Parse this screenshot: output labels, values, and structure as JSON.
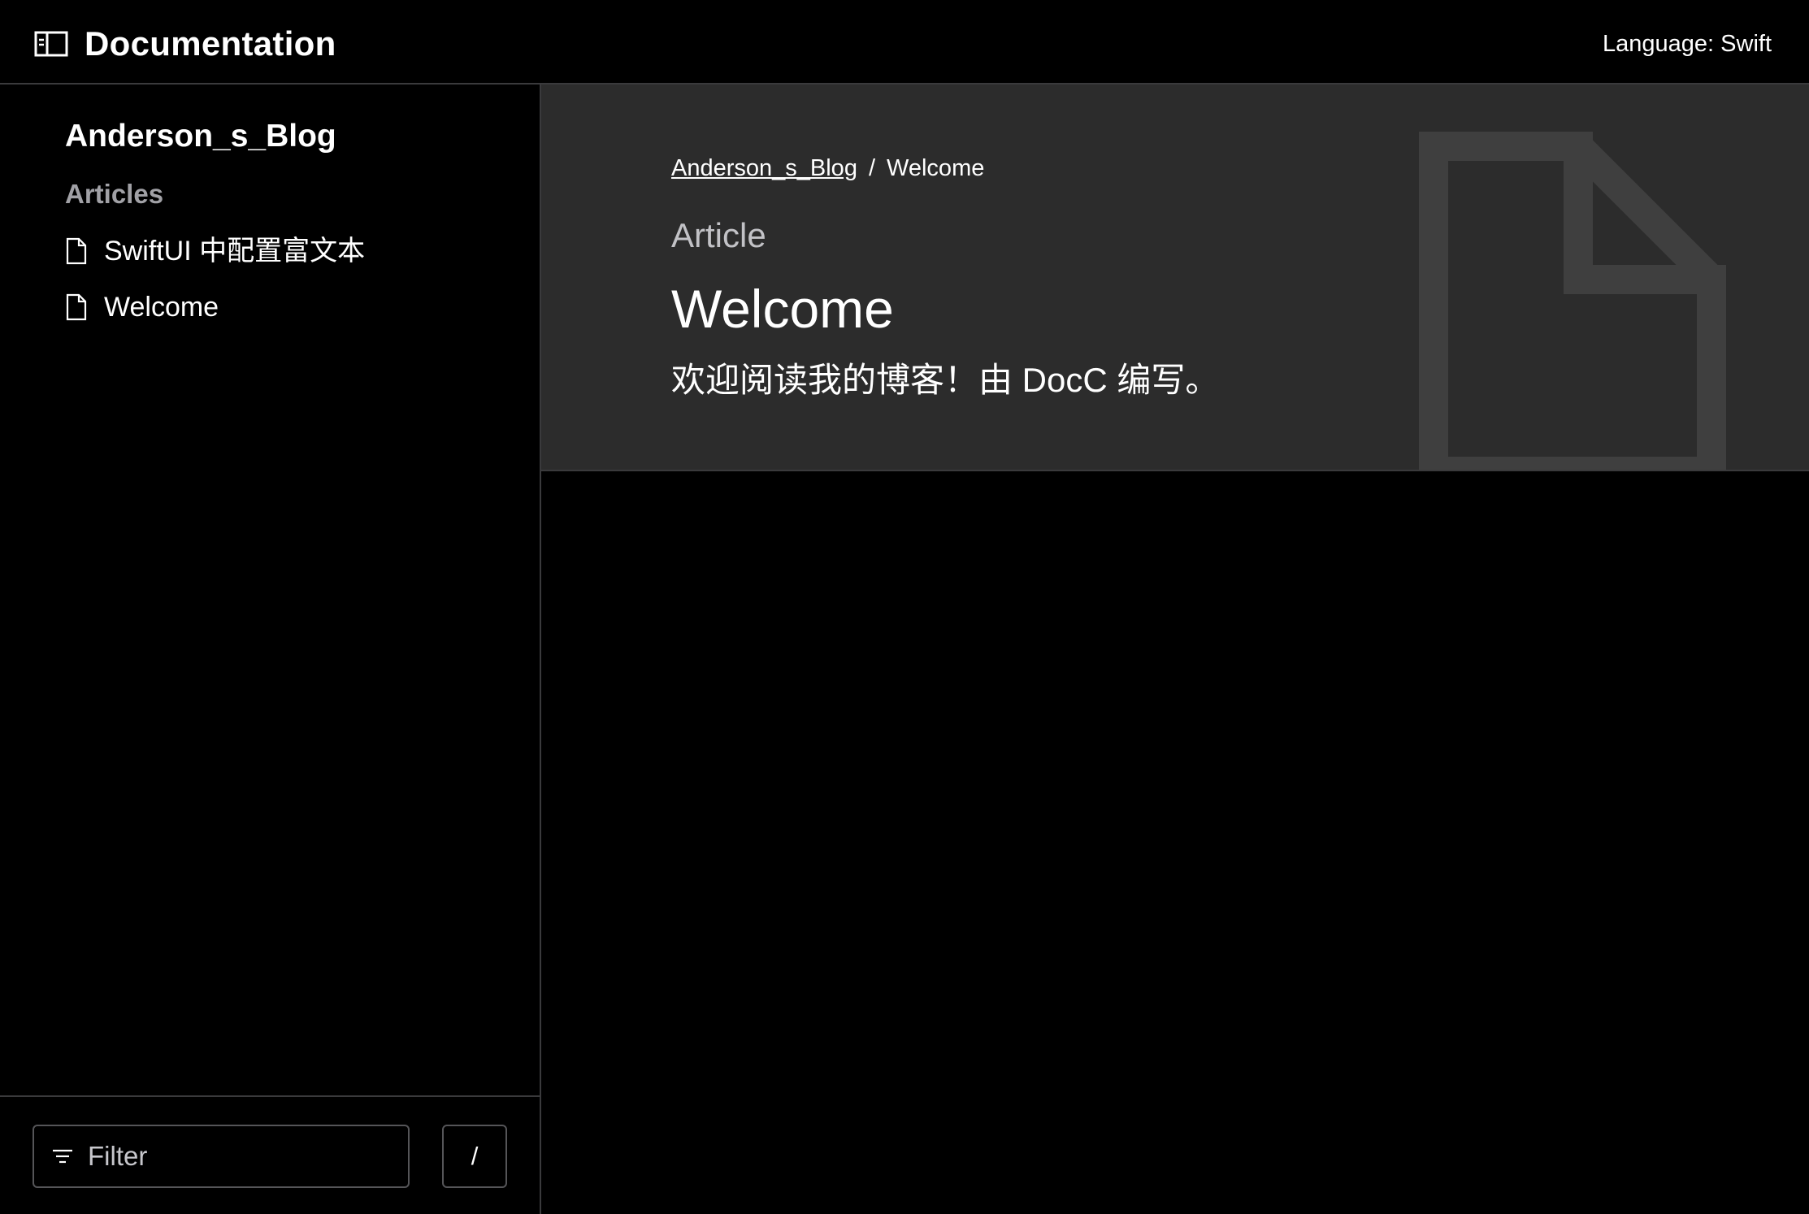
{
  "topbar": {
    "title": "Documentation",
    "language": "Language: Swift",
    "sidebar_toggle_icon": "sidebar-toggle-icon"
  },
  "sidebar": {
    "technology": "Anderson_s_Blog",
    "section": "Articles",
    "items": [
      {
        "label": "SwiftUI 中配置富文本",
        "icon": "article-icon"
      },
      {
        "label": "Welcome",
        "icon": "article-icon"
      }
    ],
    "filter": {
      "placeholder": "Filter",
      "value": "",
      "icon": "filter-icon",
      "shortcut": "/"
    }
  },
  "main": {
    "breadcrumb": {
      "parent": "Anderson_s_Blog",
      "separator": "/",
      "current": "Welcome"
    },
    "eyebrow": "Article",
    "title": "Welcome",
    "abstract": "欢迎阅读我的博客！由 DocC 编写。",
    "hero_icon": "article-icon"
  },
  "colors": {
    "background": "#000000",
    "hero_background": "#2c2c2c",
    "hero_icon": "#3f3f3f",
    "border": "#3a3a3c",
    "secondary_text": "#a1a1a6",
    "text": "#ffffff"
  }
}
